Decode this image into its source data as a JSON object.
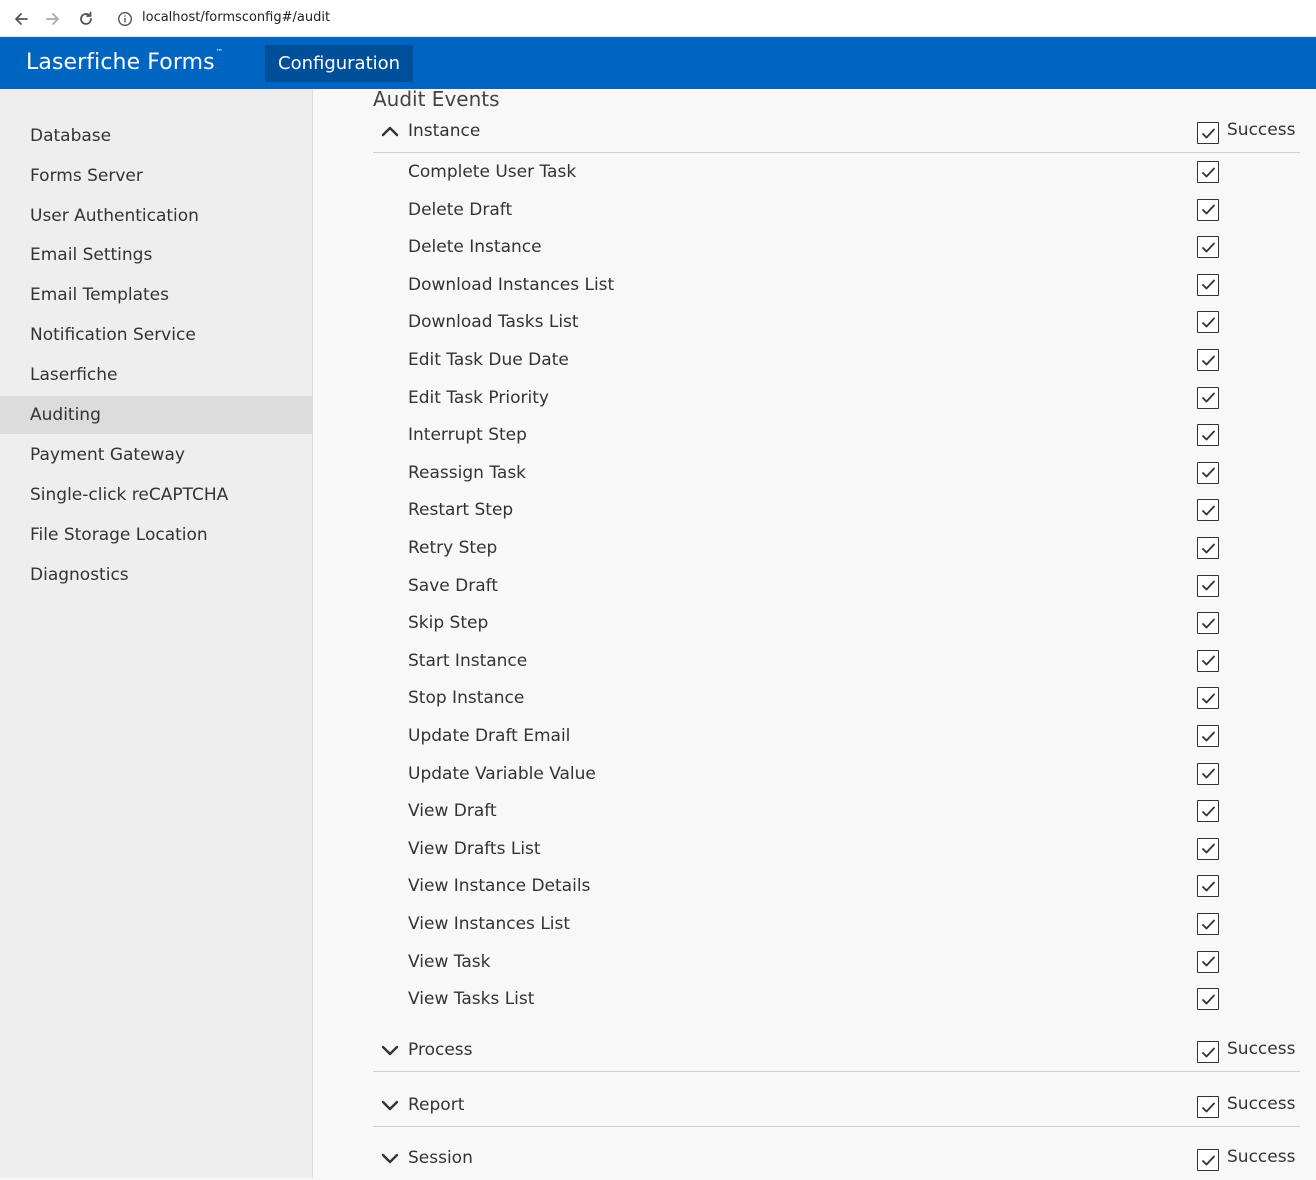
{
  "browser": {
    "url": "localhost/formsconfig#/audit"
  },
  "header": {
    "brand": "Laserfiche Forms",
    "trademark": "™",
    "config_tab": "Configuration"
  },
  "sidebar": {
    "items": [
      {
        "label": "Database",
        "active": false
      },
      {
        "label": "Forms Server",
        "active": false
      },
      {
        "label": "User Authentication",
        "active": false
      },
      {
        "label": "Email Settings",
        "active": false
      },
      {
        "label": "Email Templates",
        "active": false
      },
      {
        "label": "Notification Service",
        "active": false
      },
      {
        "label": "Laserfiche",
        "active": false
      },
      {
        "label": "Auditing",
        "active": true
      },
      {
        "label": "Payment Gateway",
        "active": false
      },
      {
        "label": "Single-click reCAPTCHA",
        "active": false
      },
      {
        "label": "File Storage Location",
        "active": false
      },
      {
        "label": "Diagnostics",
        "active": false
      }
    ]
  },
  "main": {
    "title": "Audit Events",
    "sections": [
      {
        "label": "Instance",
        "expanded": true,
        "success_label": "Success",
        "success_checked": true,
        "events": [
          {
            "label": "Complete User Task",
            "checked": true
          },
          {
            "label": "Delete Draft",
            "checked": true
          },
          {
            "label": "Delete Instance",
            "checked": true
          },
          {
            "label": "Download Instances List",
            "checked": true
          },
          {
            "label": "Download Tasks List",
            "checked": true
          },
          {
            "label": "Edit Task Due Date",
            "checked": true
          },
          {
            "label": "Edit Task Priority",
            "checked": true
          },
          {
            "label": "Interrupt Step",
            "checked": true
          },
          {
            "label": "Reassign Task",
            "checked": true
          },
          {
            "label": "Restart Step",
            "checked": true
          },
          {
            "label": "Retry Step",
            "checked": true
          },
          {
            "label": "Save Draft",
            "checked": true
          },
          {
            "label": "Skip Step",
            "checked": true
          },
          {
            "label": "Start Instance",
            "checked": true
          },
          {
            "label": "Stop Instance",
            "checked": true
          },
          {
            "label": "Update Draft Email",
            "checked": true
          },
          {
            "label": "Update Variable Value",
            "checked": true
          },
          {
            "label": "View Draft",
            "checked": true
          },
          {
            "label": "View Drafts List",
            "checked": true
          },
          {
            "label": "View Instance Details",
            "checked": true
          },
          {
            "label": "View Instances List",
            "checked": true
          },
          {
            "label": "View Task",
            "checked": true
          },
          {
            "label": "View Tasks List",
            "checked": true
          }
        ]
      },
      {
        "label": "Process",
        "expanded": false,
        "success_label": "Success",
        "success_checked": true
      },
      {
        "label": "Report",
        "expanded": false,
        "success_label": "Success",
        "success_checked": true
      },
      {
        "label": "Session",
        "expanded": false,
        "success_label": "Success",
        "success_checked": true
      }
    ]
  }
}
